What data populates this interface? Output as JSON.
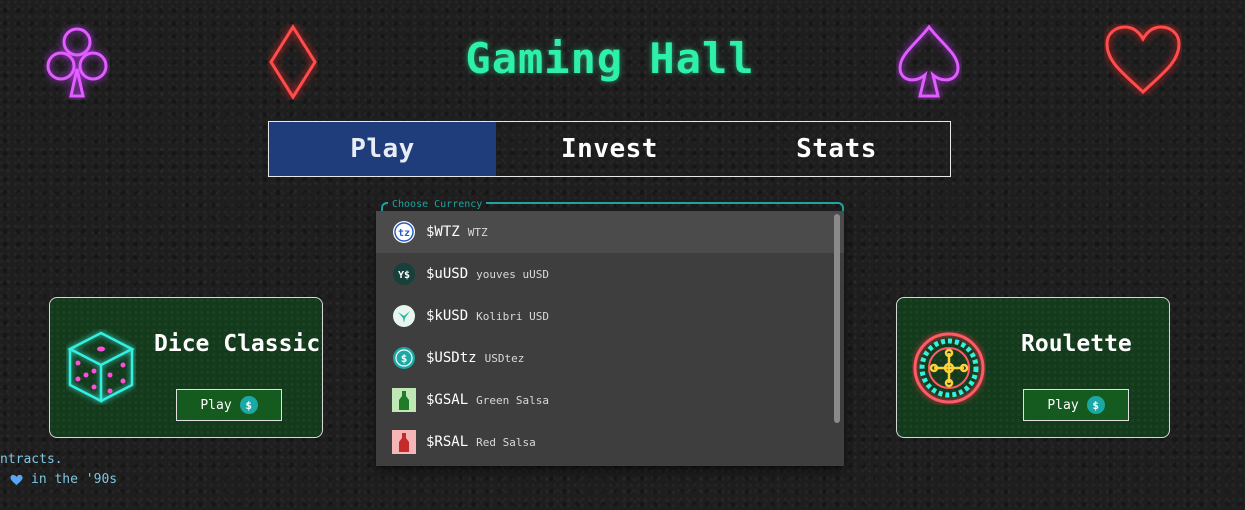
{
  "header": {
    "title": "Gaming Hall"
  },
  "suits": [
    "club-icon",
    "diamond-icon",
    "spade-icon",
    "heart-icon"
  ],
  "tabs": [
    {
      "label": "Play",
      "active": true
    },
    {
      "label": "Invest",
      "active": false
    },
    {
      "label": "Stats",
      "active": false
    }
  ],
  "currency": {
    "legend": "Choose Currency",
    "options": [
      {
        "symbol": "$WTZ",
        "name": "WTZ",
        "icon": "wtz-token-icon"
      },
      {
        "symbol": "$uUSD",
        "name": "youves uUSD",
        "icon": "uusd-token-icon"
      },
      {
        "symbol": "$kUSD",
        "name": "Kolibri USD",
        "icon": "kusd-token-icon"
      },
      {
        "symbol": "$USDtz",
        "name": "USDtez",
        "icon": "usdtz-token-icon"
      },
      {
        "symbol": "$GSAL",
        "name": "Green Salsa",
        "icon": "gsal-token-icon"
      },
      {
        "symbol": "$RSAL",
        "name": "Red Salsa",
        "icon": "rsal-token-icon"
      }
    ]
  },
  "games": [
    {
      "title": "Dice Classic",
      "button": "Play",
      "icon": "dice-icon"
    },
    {
      "title": "Roulette",
      "button": "Play",
      "icon": "roulette-wheel-icon"
    }
  ],
  "footer": {
    "line1": "ntracts.",
    "line2": "in the '90s"
  },
  "colors": {
    "accent": "#2ef0a8",
    "tab_active": "#1f3d7a",
    "card_bg": "#143a1c",
    "teal": "#1fa6a0"
  }
}
